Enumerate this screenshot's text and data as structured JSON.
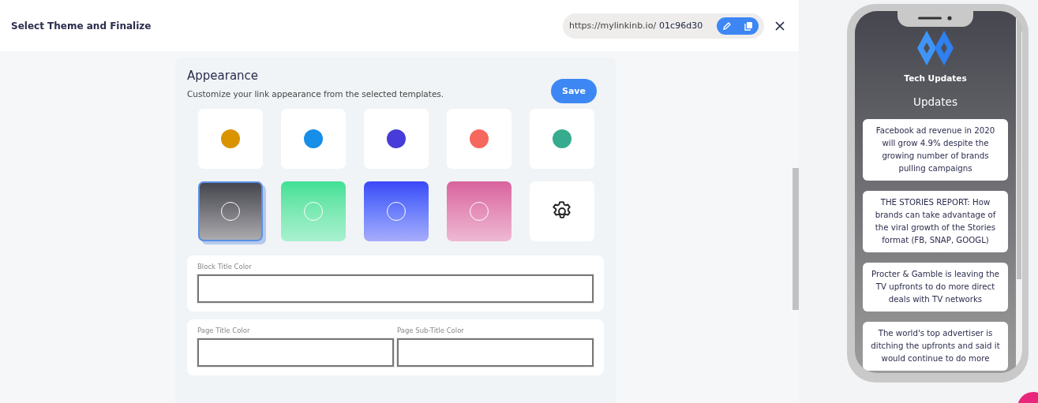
{
  "header": {
    "title": "Select Theme and Finalize",
    "url_prefix": "https://mylinkinb.io/",
    "url_slug": "01c96d30"
  },
  "appearance": {
    "title": "Appearance",
    "description": "Customize your link appearance from the selected templates.",
    "save_label": "Save",
    "themes": [
      {
        "kind": "color",
        "color": "#d99400",
        "selected": false
      },
      {
        "kind": "color",
        "color": "#178ee8",
        "selected": false
      },
      {
        "kind": "color",
        "color": "#473bd9",
        "selected": false
      },
      {
        "kind": "color",
        "color": "#f6685e",
        "selected": false
      },
      {
        "kind": "color",
        "color": "#37ab8d",
        "selected": false
      },
      {
        "kind": "gradient",
        "color": "#46464e",
        "selected": true
      },
      {
        "kind": "gradient",
        "color": "#3ee096",
        "selected": false
      },
      {
        "kind": "gradient",
        "color": "#3c47f7",
        "selected": false
      },
      {
        "kind": "gradient",
        "color": "#d8639e",
        "selected": false
      },
      {
        "kind": "custom",
        "selected": false
      }
    ],
    "field_groups": [
      {
        "fields": [
          {
            "label": "Block Title Color"
          }
        ]
      },
      {
        "fields": [
          {
            "label": "Page Title Color"
          },
          {
            "label": "Page Sub-Title Color"
          }
        ]
      }
    ]
  },
  "preview": {
    "title": "Tech Updates",
    "section": "Updates",
    "links": [
      {
        "text": "Facebook ad revenue in 2020 will grow 4.9% despite the growing number of brands pulling campaigns"
      },
      {
        "text": "THE STORIES REPORT: How brands can take advantage of the viral growth of the Stories format (FB, SNAP, GOOGL)"
      },
      {
        "text": "Procter & Gamble is leaving the TV upfronts to do more direct deals with TV networks"
      },
      {
        "text": "The world's top advertiser is ditching the upfronts and said it would continue to do more"
      }
    ]
  }
}
